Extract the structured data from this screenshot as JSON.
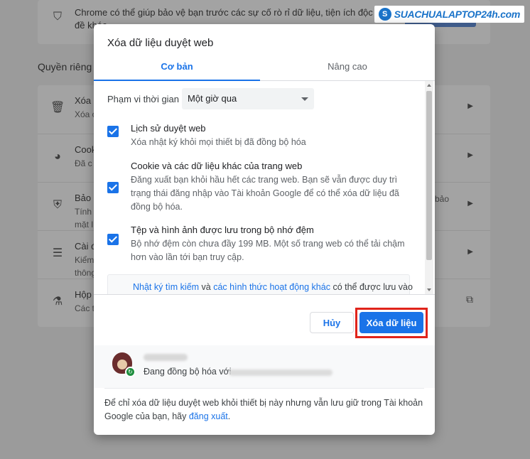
{
  "background": {
    "top_text": "Chrome có thể giúp bảo vệ bạn trước các sự cố rò rỉ dữ liệu, tiện ích độc hại và những vấn đề khác",
    "section_title": "Quyền riêng t",
    "rows": [
      {
        "icon": "trash-icon",
        "t1": "Xóa c",
        "t2": "Xóa c",
        "arrow": "▶"
      },
      {
        "icon": "cookie-icon",
        "t1": "Cook",
        "t2": "Đã c",
        "arrow": "▶"
      },
      {
        "icon": "shield-icon",
        "t1": "Bảo m",
        "t2": "Tính",
        "t3": "mặt l",
        "arrow": "▶"
      },
      {
        "icon": "sliders-icon",
        "t1": "Cài đ",
        "t2": "Kiểm",
        "t3": "thông",
        "arrow": "▶"
      },
      {
        "icon": "flask-icon",
        "t1": "Hộp",
        "t2": "Các t",
        "arrow": "⧉"
      }
    ],
    "side_text": "bảo"
  },
  "logo": {
    "text": "SUACHUALAPTOP24h.com",
    "circle": "S"
  },
  "dialog": {
    "title": "Xóa dữ liệu duyệt web",
    "tabs": {
      "basic": "Cơ bản",
      "advanced": "Nâng cao"
    },
    "time_range": {
      "label": "Phạm vi thời gian",
      "selected": "Một giờ qua"
    },
    "items": [
      {
        "title": "Lịch sử duyệt web",
        "desc": "Xóa nhật ký khỏi mọi thiết bị đã đồng bộ hóa",
        "checked": true
      },
      {
        "title": "Cookie và các dữ liệu khác của trang web",
        "desc": "Đăng xuất bạn khỏi hầu hết các trang web. Bạn sẽ vẫn được duy trì trạng thái đăng nhập vào Tài khoản Google để có thể xóa dữ liệu đã đồng bộ hóa.",
        "checked": true
      },
      {
        "title": "Tệp và hình ảnh được lưu trong bộ nhớ đệm",
        "desc": "Bộ nhớ đệm còn chưa đầy 199 MB. Một số trang web có thể tải chậm hơn vào lần tới bạn truy cập.",
        "checked": true
      }
    ],
    "info": {
      "link1": "Nhật ký tìm kiếm",
      "mid": " và ",
      "link2": "các hình thức hoạt động khác",
      "tail": " có thể được lưu vào"
    },
    "buttons": {
      "cancel": "Hủy",
      "clear": "Xóa dữ liệu"
    },
    "account": {
      "sync_text": "Đang đồng bộ hóa với"
    },
    "bottom_note": {
      "text": "Để chỉ xóa dữ liệu duyệt web khỏi thiết bị này nhưng vẫn lưu giữ trong Tài khoản Google của bạn, hãy ",
      "link": "đăng xuất",
      "end": "."
    }
  },
  "colors": {
    "accent": "#1a73e8",
    "highlight": "#e0241b"
  }
}
